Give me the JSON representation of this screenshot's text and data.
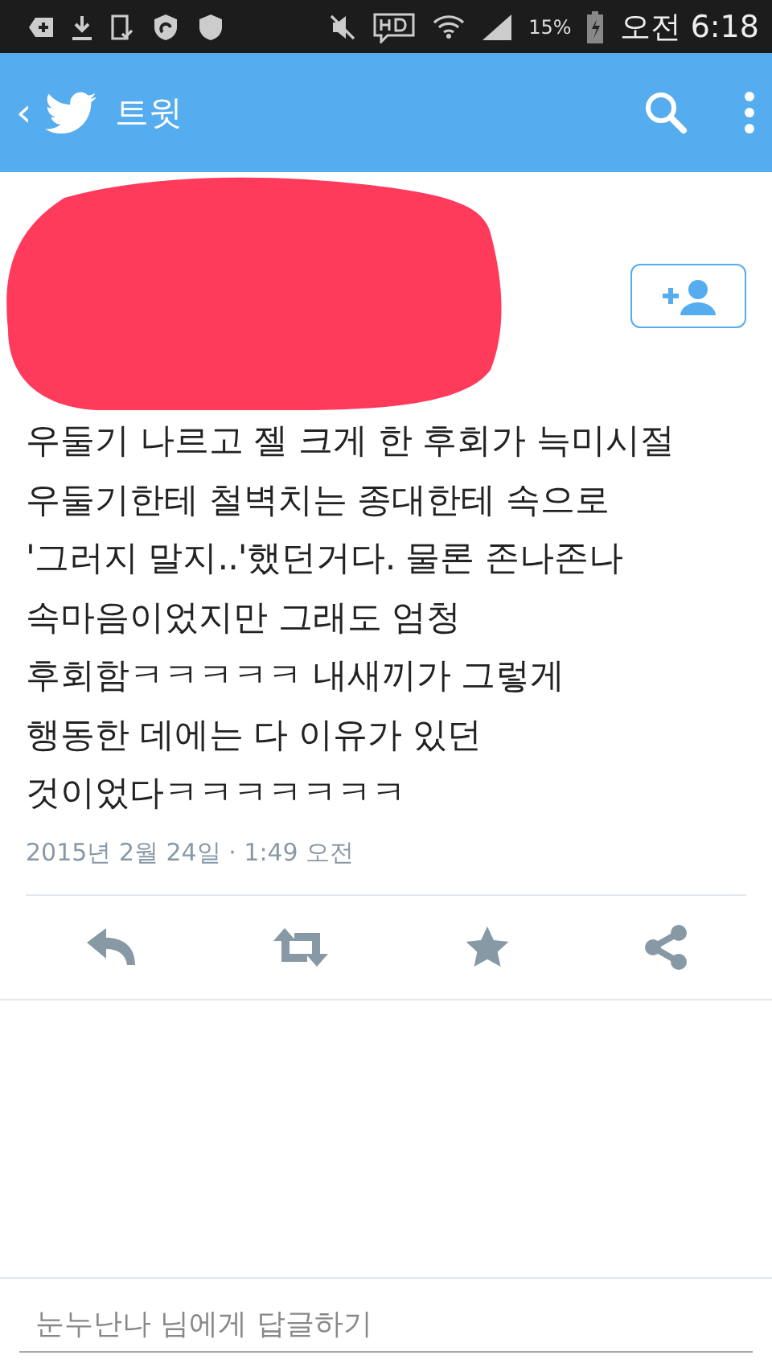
{
  "status_bar": {
    "battery": "15%",
    "time": "오전 6:18"
  },
  "app_bar": {
    "back": "‹",
    "title": "트윗"
  },
  "tweet": {
    "text": "우둘기 나르고 젤 크게 한 후회가 늑미시절\n우둘기한테 철벽치는 종대한테 속으로\n'그러지 말지..'했던거다. 물론 존나존나\n속마음이었지만 그래도 엄청\n후회함ㅋㅋㅋㅋㅋ 내새끼가 그렇게\n행동한 데에는 다 이유가 있던\n것이었다ㅋㅋㅋㅋㅋㅋㅋ",
    "timestamp": "2015년 2월 24일 · 1:49 오전"
  },
  "reply": {
    "placeholder": "눈누난나 님에게 답글하기"
  }
}
